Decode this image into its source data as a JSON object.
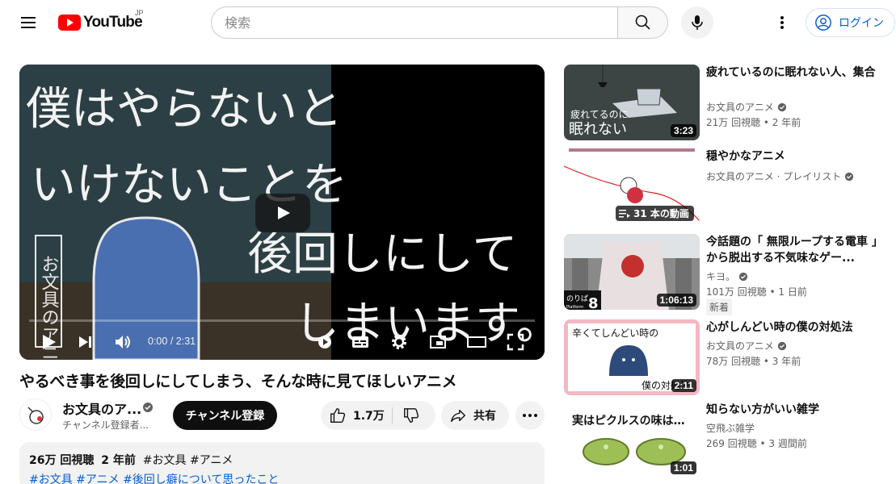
{
  "header": {
    "logo_text": "YouTube",
    "region": "JP",
    "search_placeholder": "検索",
    "login_label": "ログイン"
  },
  "player": {
    "time_current": "0:00",
    "time_total": "2:31",
    "time_separator": " / ",
    "progress": 0,
    "caption_lines": [
      "僕はやらないと",
      "いけないことを",
      "後回しにして",
      "しまいます。"
    ],
    "vertical_text": "お文具のアニメ"
  },
  "video": {
    "title": "やるべき事を後回しにしてしまう、そんな時に見てほしいアニメ",
    "channel_name": "お文具のア...",
    "subscribers": "チャンネル登録者...",
    "subscribe_label": "チャンネル登録",
    "like_count": "1.7万",
    "share_label": "共有",
    "description": {
      "views": "26万 回視聴",
      "age": "2 年前",
      "tags_line1": "#お文具 #アニメ",
      "tags_line2": "#お文具 #アニメ #後回し癖について思ったこと"
    }
  },
  "recommendations": [
    {
      "title": "疲れているのに眠れない人、集合",
      "channel": "お文具のアニメ",
      "verified": true,
      "meta": "21万 回視聴 • 2 年前",
      "duration": "3:23",
      "thumb_text": [
        "疲れてるのに",
        "眠れない"
      ]
    },
    {
      "title": "穏やかなアニメ",
      "channel": "お文具のアニメ · プレイリスト",
      "verified": true,
      "meta": "",
      "video_count": "31 本の動画"
    },
    {
      "title": "今話題の「 無限ループする電車 」から脱出する不気味なゲー...",
      "channel": "キヨ。",
      "verified": true,
      "meta": "101万 回視聴 • 1 日前",
      "badge": "新着",
      "duration": "1:06:13",
      "thumb_text": [
        "のりば",
        "8",
        "Platform"
      ]
    },
    {
      "title": "心がしんどい時の僕の対処法",
      "channel": "お文具のアニメ",
      "verified": true,
      "meta": "78万 回視聴 • 3 年前",
      "duration": "2:11",
      "thumb_text": [
        "辛くてしんどい時の",
        "僕の対処法"
      ]
    },
    {
      "title": "知らない方がいい雑学",
      "channel": "空飛ぶ雑学",
      "verified": false,
      "meta": "269 回視聴 • 3 週間前",
      "duration": "1:01",
      "thumb_text": [
        "実はピクルスの味は…"
      ]
    }
  ]
}
